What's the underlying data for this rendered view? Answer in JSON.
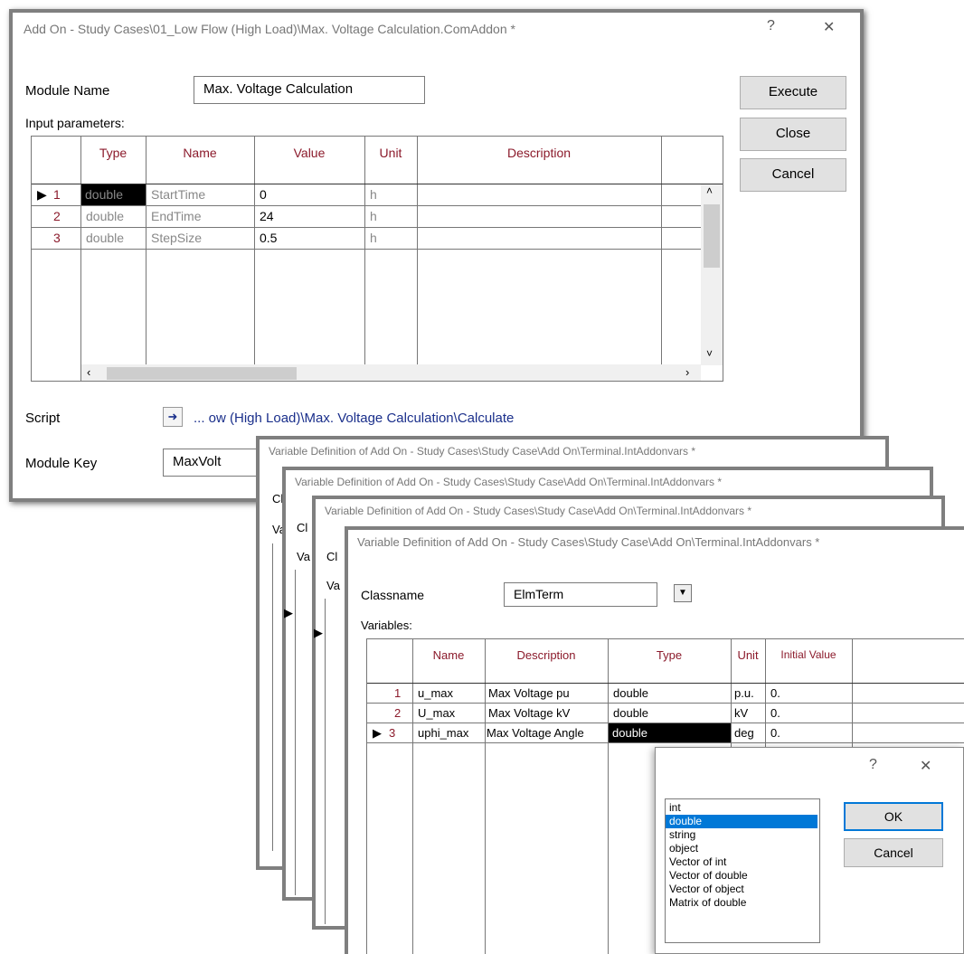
{
  "main_dialog": {
    "title": "Add On - Study Cases\\01_Low Flow (High Load)\\Max. Voltage Calculation.ComAddon *",
    "help": "?",
    "close": "✕",
    "module_name_label": "Module Name",
    "module_name_value": "Max. Voltage Calculation",
    "input_parameters_label": "Input parameters:",
    "buttons": {
      "execute": "Execute",
      "close": "Close",
      "cancel": "Cancel"
    },
    "table": {
      "headers": [
        "Type",
        "Name",
        "Value",
        "Unit",
        "Description"
      ],
      "rows": [
        {
          "num": "1",
          "marker": "▶",
          "type": "double",
          "name": "StartTime",
          "value": "0",
          "unit": "h",
          "description": ""
        },
        {
          "num": "2",
          "marker": "",
          "type": "double",
          "name": "EndTime",
          "value": "24",
          "unit": "h",
          "description": ""
        },
        {
          "num": "3",
          "marker": "",
          "type": "double",
          "name": "StepSize",
          "value": "0.5",
          "unit": "h",
          "description": ""
        }
      ]
    },
    "script_label": "Script",
    "script_value": "... ow (High Load)\\Max. Voltage Calculation\\Calculate",
    "module_key_label": "Module Key",
    "module_key_value": "MaxVolt"
  },
  "var_dialogs_back": [
    {
      "title": "Variable Definition of Add On - Study Cases\\Study Case\\Add On\\Terminal.IntAddonvars *",
      "classname_frag": "Cl",
      "variables_frag": "Va"
    },
    {
      "title": "Variable Definition of Add On - Study Cases\\Study Case\\Add On\\Terminal.IntAddonvars *",
      "classname_frag": "Cl",
      "variables_frag": "Va"
    },
    {
      "title": "Variable Definition of Add On - Study Cases\\Study Case\\Add On\\Terminal.IntAddonvars *",
      "classname_frag": "Cl",
      "variables_frag": "Va"
    }
  ],
  "var_dialog": {
    "title": "Variable Definition of Add On - Study Cases\\Study Case\\Add On\\Terminal.IntAddonvars *",
    "classname_label": "Classname",
    "classname_value": "ElmTerm",
    "variables_label": "Variables:",
    "table": {
      "headers": [
        "Name",
        "Description",
        "Type",
        "Unit",
        "Initial Value"
      ],
      "rows": [
        {
          "num": "1",
          "marker": "",
          "name": "u_max",
          "description": "Max Voltage pu",
          "type": "double",
          "unit": "p.u.",
          "initial": "0."
        },
        {
          "num": "2",
          "marker": "",
          "name": "U_max",
          "description": "Max Voltage kV",
          "type": "double",
          "unit": "kV",
          "initial": "0."
        },
        {
          "num": "3",
          "marker": "▶",
          "name": "uphi_max",
          "description": "Max Voltage Angle",
          "type": "double",
          "unit": "deg",
          "initial": "0."
        }
      ]
    }
  },
  "type_popup": {
    "help": "?",
    "close": "✕",
    "options": [
      "int",
      "double",
      "string",
      "object",
      "Vector of int",
      "Vector of double",
      "Vector of object",
      "Matrix of double"
    ],
    "selected": "double",
    "ok": "OK",
    "cancel": "Cancel"
  }
}
